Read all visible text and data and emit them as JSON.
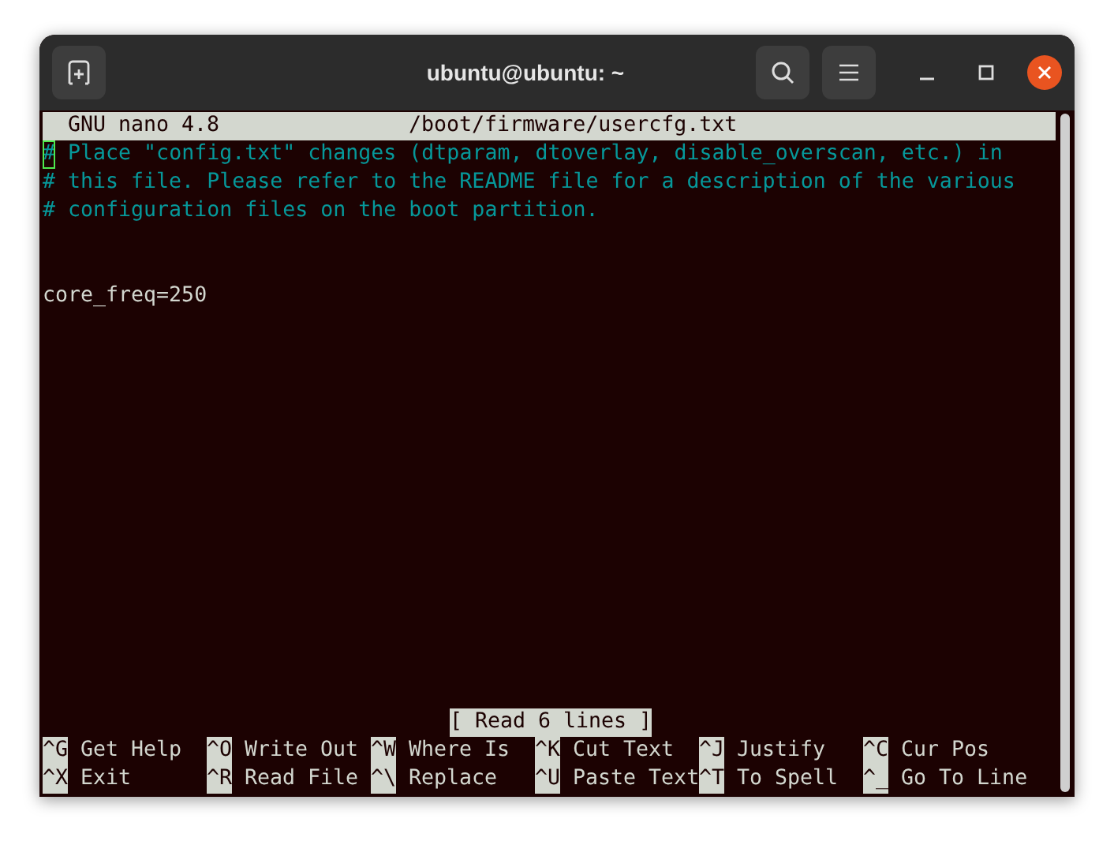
{
  "window": {
    "title": "ubuntu@ubuntu: ~"
  },
  "editor": {
    "program": "GNU nano 4.8",
    "filename": "/boot/firmware/usercfg.txt",
    "lines": [
      {
        "kind": "comment",
        "text": "# Place \"config.txt\" changes (dtparam, dtoverlay, disable_overscan, etc.) in"
      },
      {
        "kind": "comment",
        "text": "# this file. Please refer to the README file for a description of the various"
      },
      {
        "kind": "comment",
        "text": "# configuration files on the boot partition."
      },
      {
        "kind": "blank"
      },
      {
        "kind": "blank"
      },
      {
        "kind": "plain",
        "text": "core_freq=250"
      }
    ],
    "status": "[ Read 6 lines ]",
    "shortcuts": [
      [
        {
          "key": "^G",
          "label": "Get Help"
        },
        {
          "key": "^O",
          "label": "Write Out"
        },
        {
          "key": "^W",
          "label": "Where Is"
        },
        {
          "key": "^K",
          "label": "Cut Text"
        },
        {
          "key": "^J",
          "label": "Justify"
        },
        {
          "key": "^C",
          "label": "Cur Pos"
        }
      ],
      [
        {
          "key": "^X",
          "label": "Exit"
        },
        {
          "key": "^R",
          "label": "Read File"
        },
        {
          "key": "^\\",
          "label": "Replace"
        },
        {
          "key": "^U",
          "label": "Paste Text"
        },
        {
          "key": "^T",
          "label": "To Spell"
        },
        {
          "key": "^_",
          "label": "Go To Line"
        }
      ]
    ]
  }
}
